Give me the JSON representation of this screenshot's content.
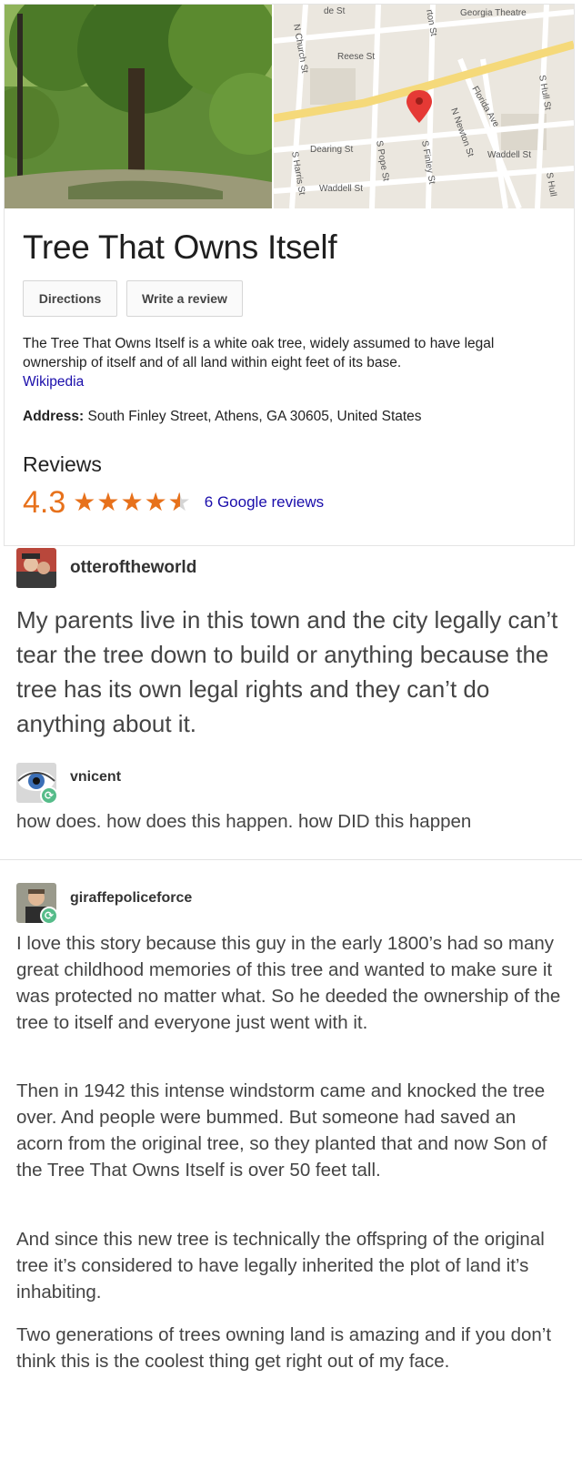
{
  "place": {
    "title": "Tree That Owns Itself",
    "buttons": {
      "directions": "Directions",
      "review": "Write a review"
    },
    "description": "The Tree That Owns Itself is a white oak tree, widely assumed to have legal ownership of itself and of all land within eight feet of its base.",
    "wiki_link": "Wikipedia",
    "address_label": "Address:",
    "address_value": " South Finley Street, Athens, GA 30605, United States",
    "reviews_heading": "Reviews",
    "rating": "4.3",
    "rating_value": 4.3,
    "review_count": "6 Google reviews",
    "accent_color": "#e7711b",
    "link_color": "#1a0dab"
  },
  "map": {
    "labels": [
      "Georgia Theatre",
      "de St",
      "N Church St",
      "Reese St",
      "rton St",
      "Florida Ave",
      "S Hull St",
      "N Newton St",
      "Dearing St",
      "Waddell St",
      "S Harris St",
      "Waddell St",
      "S Pope St",
      "S Finley St",
      "S Hull"
    ]
  },
  "posts": [
    {
      "username": "otteroftheworld",
      "text": "My parents live in this town and the city legally can’t tear the tree down to build or anything because the tree has its own legal rights and they can’t do anything about it."
    },
    {
      "username": "vnicent",
      "text": "how does. how does this happen. how DID this happen"
    },
    {
      "username": "giraffepoliceforce",
      "paragraphs": [
        "I love this story because this guy in the early 1800’s had so many great childhood memories of this tree and wanted to make sure it was protected no matter what. So he deeded the ownership of the tree to itself and everyone just went with it.",
        "Then in 1942 this intense windstorm came and knocked the tree over. And people were bummed. But someone had saved an acorn from the original tree, so they planted that and now Son of the Tree That Owns Itself is over 50 feet tall.",
        "And since this new tree is technically the offspring of the original tree it’s considered to have legally inherited the plot of land it’s inhabiting.",
        "Two generations of trees owning land is amazing and if you don’t think this is the coolest thing get right out of my face."
      ]
    }
  ]
}
